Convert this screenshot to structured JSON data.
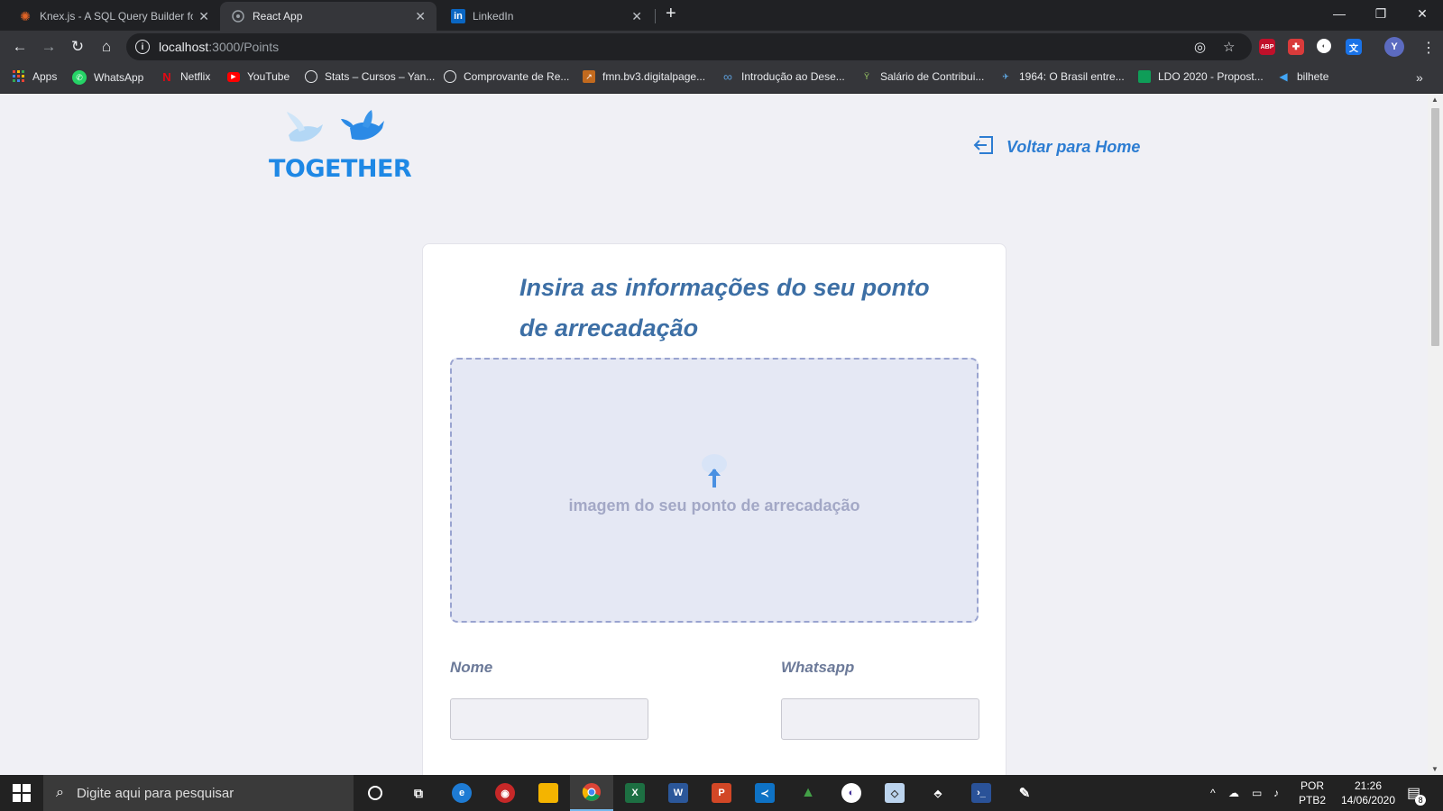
{
  "browser": {
    "tabs": [
      {
        "title": "Knex.js - A SQL Query Builder for",
        "icon": "knex-icon",
        "active": false
      },
      {
        "title": "React App",
        "icon": "react-icon",
        "active": true
      },
      {
        "title": "LinkedIn",
        "icon": "linkedin-icon",
        "active": false
      }
    ],
    "url_host": "localhost",
    "url_path": ":3000/Points",
    "profile_initial": "Y",
    "ext_abp": "ABP",
    "bookmarks": [
      {
        "label": "Apps",
        "icon": "apps-grid-icon"
      },
      {
        "label": "WhatsApp",
        "icon": "whatsapp-icon"
      },
      {
        "label": "Netflix",
        "icon": "netflix-icon"
      },
      {
        "label": "YouTube",
        "icon": "youtube-icon"
      },
      {
        "label": "Stats – Cursos – Yan...",
        "icon": "globe-icon"
      },
      {
        "label": "Comprovante de Re...",
        "icon": "globe-icon"
      },
      {
        "label": "fmn.bv3.digitalpage...",
        "icon": "arrow-icon"
      },
      {
        "label": "Introdução ao Dese...",
        "icon": "infinity-icon"
      },
      {
        "label": "Salário de Contribui...",
        "icon": "bird-icon"
      },
      {
        "label": "1964: O Brasil entre...",
        "icon": "plane-icon"
      },
      {
        "label": "LDO 2020 - Propost...",
        "icon": "sheet-icon"
      },
      {
        "label": "bilhete",
        "icon": "fish-icon"
      }
    ]
  },
  "app": {
    "logo_text": "TOGETHER",
    "back_link": "Voltar para Home",
    "form_title": "Insira as informações do seu ponto de arrecadação",
    "dropzone_text": "imagem do seu ponto de arrecadação",
    "fields": [
      {
        "label": "Nome",
        "value": ""
      },
      {
        "label": "Whatsapp",
        "value": ""
      }
    ]
  },
  "taskbar": {
    "search_placeholder": "Digite aqui para pesquisar",
    "lang_top": "POR",
    "lang_bottom": "PTB2",
    "time": "21:26",
    "date": "14/06/2020",
    "notifications": "8"
  }
}
